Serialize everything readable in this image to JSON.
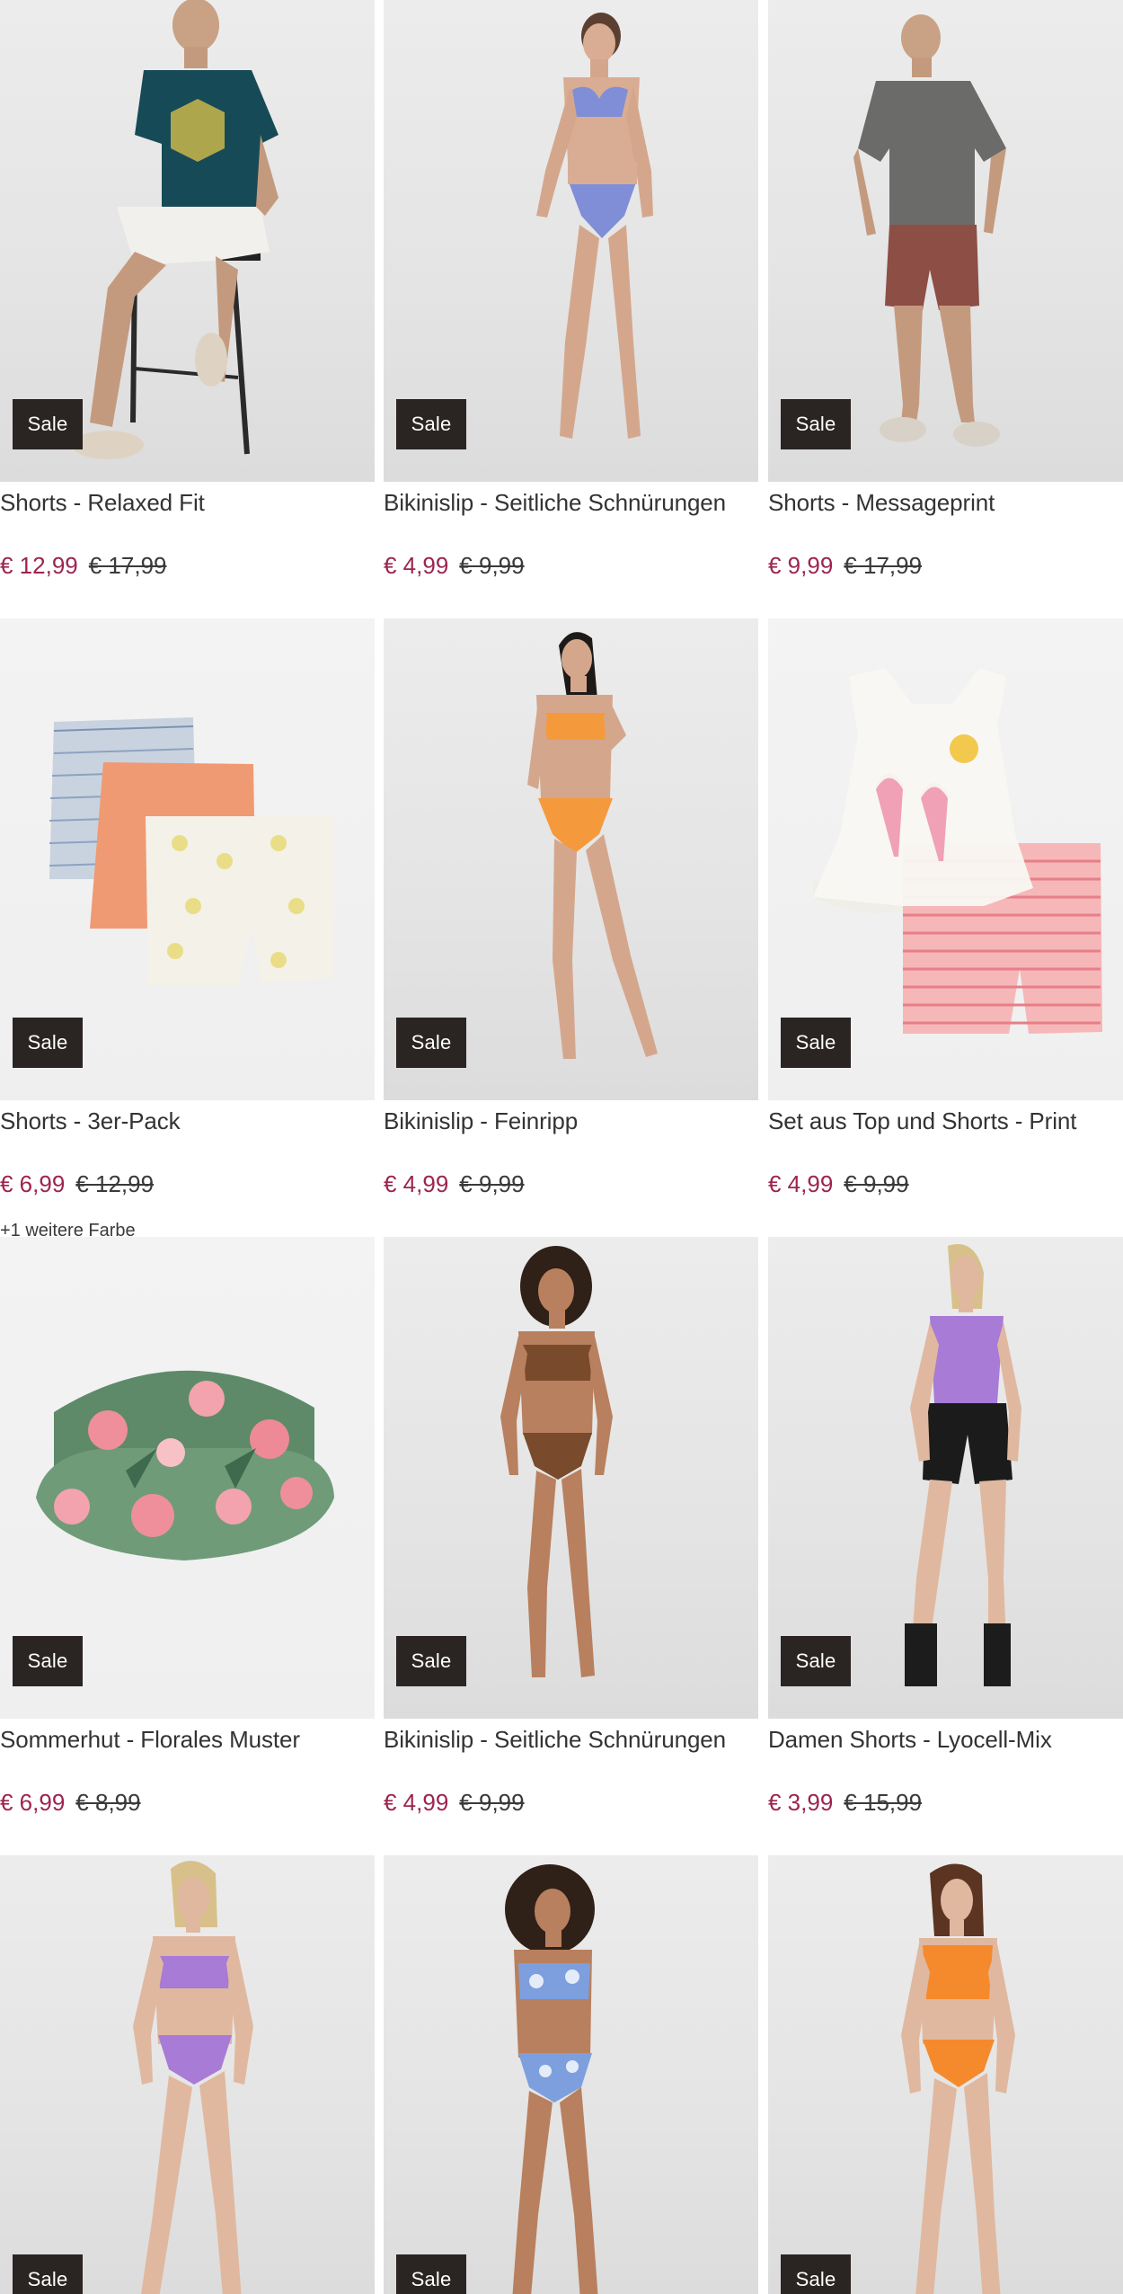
{
  "products": [
    {
      "title": "Shorts - Relaxed Fit",
      "badge": "Sale",
      "price": "€ 12,99",
      "old_price": "€ 17,99"
    },
    {
      "title": "Bikinislip - Seitliche Schnürungen",
      "badge": "Sale",
      "price": "€ 4,99",
      "old_price": "€ 9,99"
    },
    {
      "title": "Shorts - Messageprint",
      "badge": "Sale",
      "price": "€ 9,99",
      "old_price": "€ 17,99"
    },
    {
      "title": "Shorts - 3er-Pack",
      "badge": "Sale",
      "price": "€ 6,99",
      "old_price": "€ 12,99",
      "extra": "+1 weitere Farbe"
    },
    {
      "title": "Bikinislip - Feinripp",
      "badge": "Sale",
      "price": "€ 4,99",
      "old_price": "€ 9,99"
    },
    {
      "title": "Set aus Top und Shorts - Print",
      "badge": "Sale",
      "price": "€ 4,99",
      "old_price": "€ 9,99"
    },
    {
      "title": "Sommerhut - Florales Muster",
      "badge": "Sale",
      "price": "€ 6,99",
      "old_price": "€ 8,99"
    },
    {
      "title": "Bikinislip - Seitliche Schnürungen",
      "badge": "Sale",
      "price": "€ 4,99",
      "old_price": "€ 9,99"
    },
    {
      "title": "Damen Shorts - Lyocell-Mix",
      "badge": "Sale",
      "price": "€ 3,99",
      "old_price": "€ 15,99"
    },
    {
      "title": "",
      "badge": "Sale",
      "price": "",
      "old_price": ""
    },
    {
      "title": "",
      "badge": "Sale",
      "price": "",
      "old_price": ""
    },
    {
      "title": "",
      "badge": "Sale",
      "price": "",
      "old_price": ""
    }
  ],
  "colors": {
    "sale_price": "#9d2450",
    "badge_bg": "#2a2523",
    "badge_text": "#ffffff"
  }
}
